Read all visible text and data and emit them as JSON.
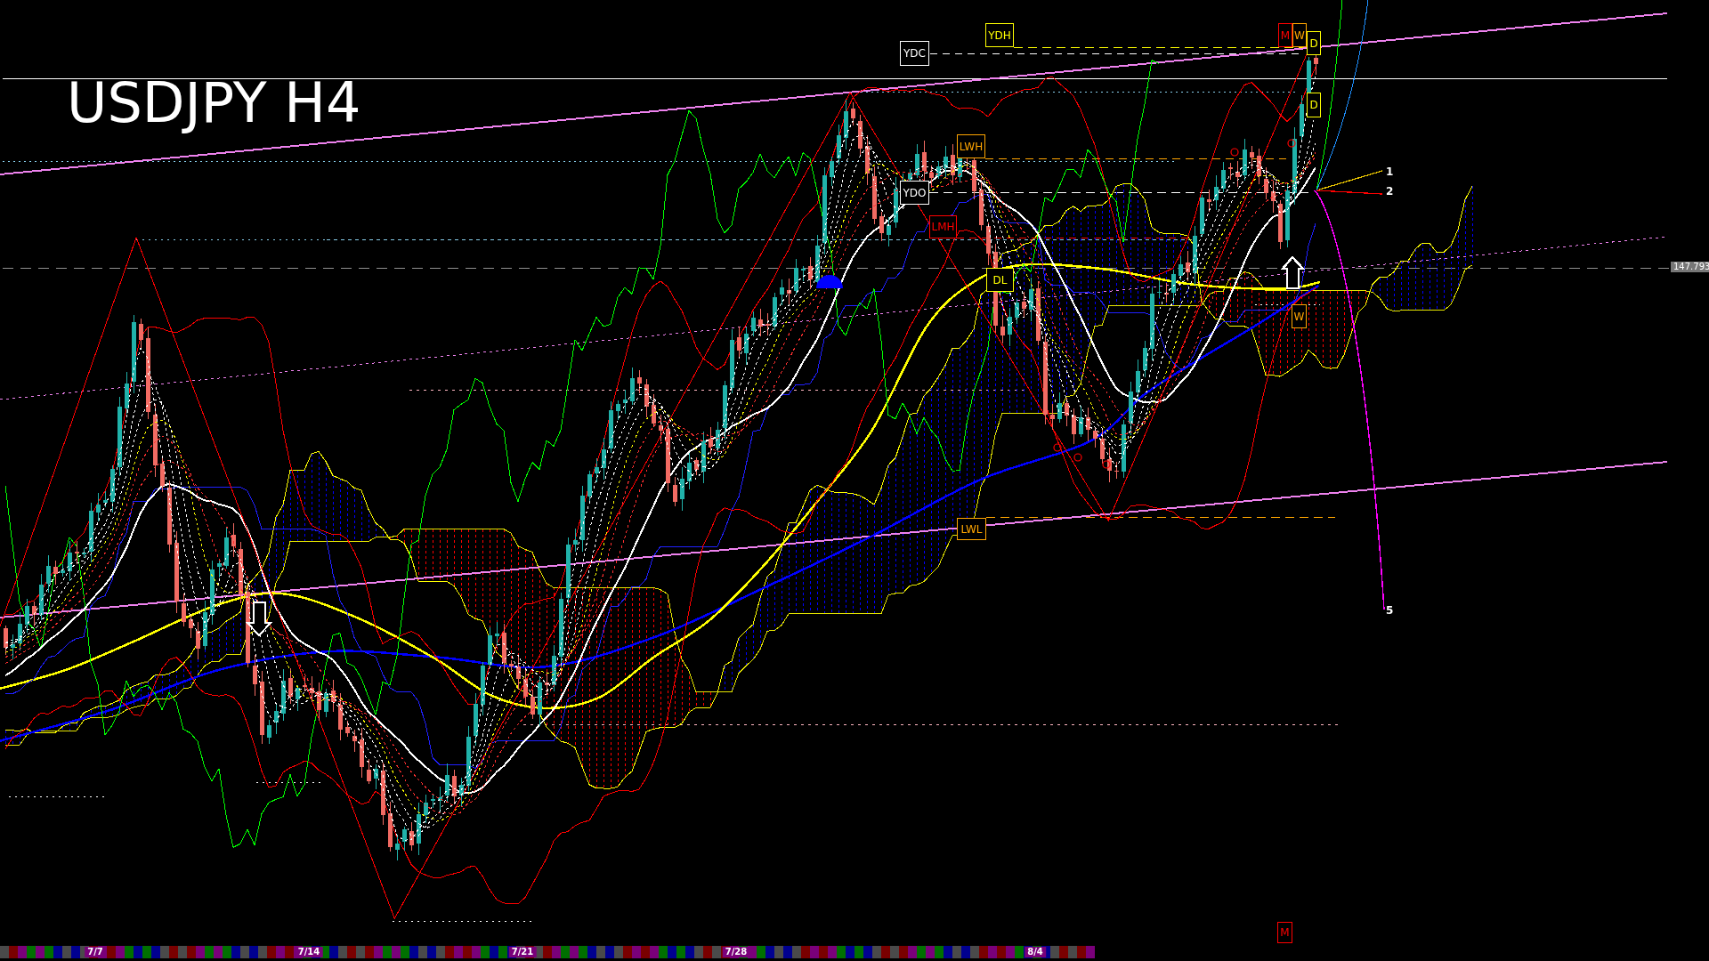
{
  "chart": {
    "title": "USDJPY H4",
    "current_price": "147.793"
  },
  "level_labels": [
    {
      "text": "YDC",
      "color": "#ffffff"
    },
    {
      "text": "YDH",
      "color": "#ffff00"
    },
    {
      "text": "M",
      "color": "#ff0000"
    },
    {
      "text": "W",
      "color": "#ffa500"
    },
    {
      "text": "D",
      "color": "#ffff00"
    },
    {
      "text": "D",
      "color": "#ffff00"
    },
    {
      "text": "LWH",
      "color": "#ffa500"
    },
    {
      "text": "YDO",
      "color": "#ffffff"
    },
    {
      "text": "LMH",
      "color": "#ff0000"
    },
    {
      "text": "DL",
      "color": "#ffff00"
    },
    {
      "text": "W",
      "color": "#ffa500"
    },
    {
      "text": "LWL",
      "color": "#ffa500"
    },
    {
      "text": "M",
      "color": "#ff0000"
    }
  ],
  "wave_labels": [
    "1",
    "2",
    "5"
  ],
  "time_axis": {
    "labels": [
      "7/7",
      "7/14",
      "7/21",
      "7/28",
      "8/4"
    ]
  }
}
